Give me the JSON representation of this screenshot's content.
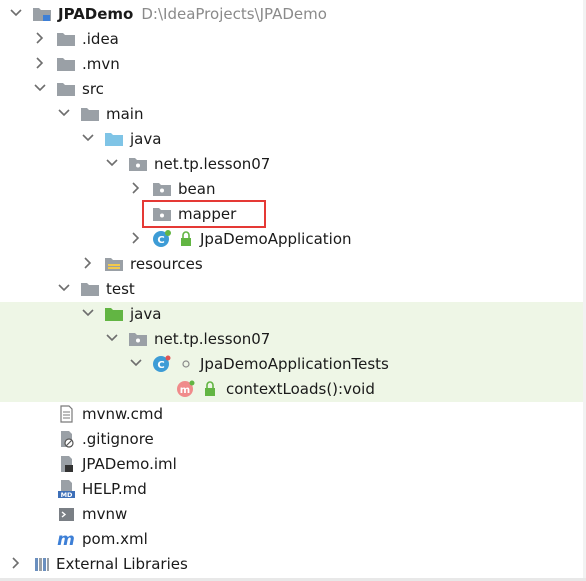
{
  "project": {
    "name": "JPADemo",
    "path": "D:\\IdeaProjects\\JPADemo"
  },
  "tree": {
    "idea": ".idea",
    "mvn": ".mvn",
    "src": "src",
    "main": "main",
    "main_java": "java",
    "main_pkg": "net.tp.lesson07",
    "bean": "bean",
    "mapper": "mapper",
    "app_class": "JpaDemoApplication",
    "resources": "resources",
    "test": "test",
    "test_java": "java",
    "test_pkg": "net.tp.lesson07",
    "test_class": "JpaDemoApplicationTests",
    "test_method": "contextLoads():void",
    "mvnw_cmd": "mvnw.cmd",
    "gitignore": ".gitignore",
    "iml": "JPADemo.iml",
    "help": "HELP.md",
    "mvnw": "mvnw",
    "pom": "pom.xml",
    "ext_libs": "External Libraries"
  },
  "badges": {
    "class_letter": "C",
    "method_letter": "m",
    "md_letter": "MD",
    "maven_letter": "m"
  },
  "colors": {
    "folder": "#9aa0a6",
    "source_folder": "#7fc4e6",
    "test_folder": "#62b543",
    "class_circle": "#3d9cd6",
    "method_circle": "#f08b8b",
    "highlight": "#e53935",
    "test_row_bg": "#eef6e6"
  }
}
